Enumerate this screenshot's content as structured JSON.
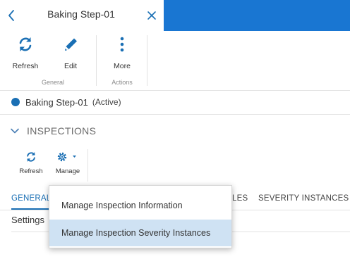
{
  "header": {
    "title": "Baking Step-01",
    "back_icon": "chevron-left-icon",
    "close_icon": "close-icon"
  },
  "command_bar": {
    "refresh_label": "Refresh",
    "edit_label": "Edit",
    "more_label": "More",
    "general_group": "General",
    "actions_group": "Actions"
  },
  "record": {
    "name": "Baking Step-01",
    "status": "(Active)",
    "status_color": "#1a6fb4"
  },
  "inspections": {
    "title": "INSPECTIONS",
    "refresh_label": "Refresh",
    "manage_label": "Manage"
  },
  "tabs": [
    {
      "label": "GENERAL",
      "active": true
    },
    {
      "label": "RULES",
      "active": false
    },
    {
      "label": "SEVERITY INSTANCES",
      "active": false
    }
  ],
  "settings_label": "Settings",
  "manage_menu": {
    "items": [
      {
        "label": "Manage Inspection Information",
        "highlighted": false
      },
      {
        "label": "Manage Inspection Severity Instances",
        "highlighted": true
      }
    ]
  },
  "colors": {
    "brand_blue": "#1976d2",
    "accent": "#1a6fb4",
    "menu_hover": "#cfe2f3"
  }
}
